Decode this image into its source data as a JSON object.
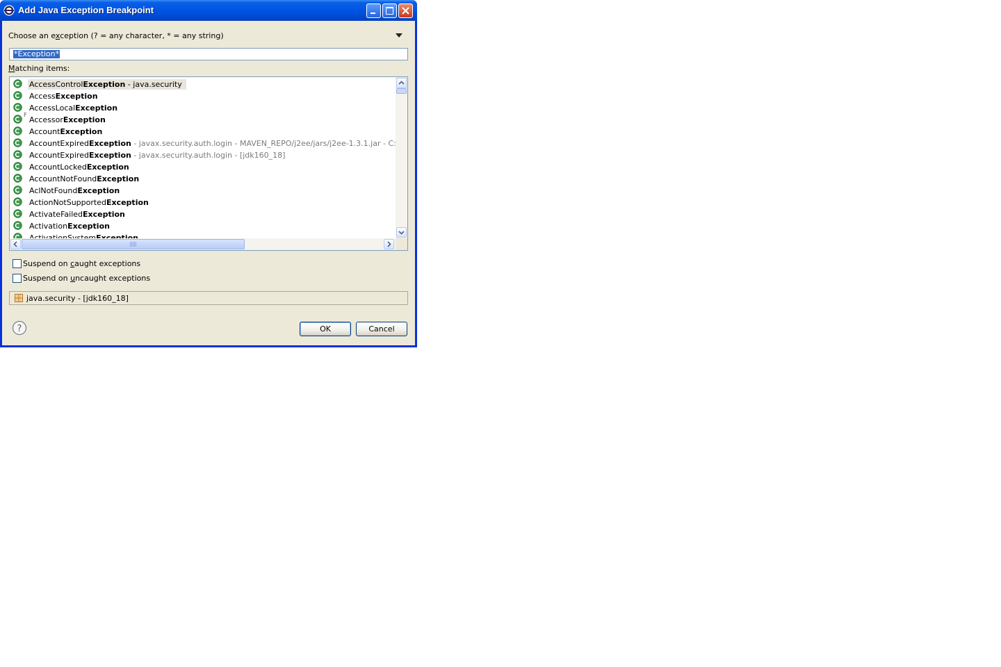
{
  "window": {
    "title": "Add Java Exception Breakpoint"
  },
  "dialog": {
    "choose_label_pre": "Choose an e",
    "choose_label_mnemonic": "x",
    "choose_label_post": "ception (? = any character, * = any string)",
    "search_value": "*Exception*",
    "matching_mnemonic": "M",
    "matching_rest": "atching items:",
    "items": [
      {
        "prefix": "AccessControl",
        "bold": "Exception",
        "qualifier": " - java.security",
        "qualifier_gray": false,
        "selected": true,
        "deco": ""
      },
      {
        "prefix": "Access",
        "bold": "Exception",
        "qualifier": "",
        "qualifier_gray": false,
        "selected": false,
        "deco": ""
      },
      {
        "prefix": "AccessLocal",
        "bold": "Exception",
        "qualifier": "",
        "qualifier_gray": false,
        "selected": false,
        "deco": ""
      },
      {
        "prefix": "Accessor",
        "bold": "Exception",
        "qualifier": "",
        "qualifier_gray": false,
        "selected": false,
        "deco": "F"
      },
      {
        "prefix": "Account",
        "bold": "Exception",
        "qualifier": "",
        "qualifier_gray": false,
        "selected": false,
        "deco": ""
      },
      {
        "prefix": "AccountExpired",
        "bold": "Exception",
        "qualifier": " - javax.security.auth.login - MAVEN_REPO/j2ee/jars/j2ee-1.3.1.jar - C:\\Documents",
        "qualifier_gray": true,
        "selected": false,
        "deco": ""
      },
      {
        "prefix": "AccountExpired",
        "bold": "Exception",
        "qualifier": " - javax.security.auth.login - [jdk160_18]",
        "qualifier_gray": true,
        "selected": false,
        "deco": ""
      },
      {
        "prefix": "AccountLocked",
        "bold": "Exception",
        "qualifier": "",
        "qualifier_gray": false,
        "selected": false,
        "deco": ""
      },
      {
        "prefix": "AccountNotFound",
        "bold": "Exception",
        "qualifier": "",
        "qualifier_gray": false,
        "selected": false,
        "deco": ""
      },
      {
        "prefix": "AclNotFound",
        "bold": "Exception",
        "qualifier": "",
        "qualifier_gray": false,
        "selected": false,
        "deco": ""
      },
      {
        "prefix": "ActionNotSupported",
        "bold": "Exception",
        "qualifier": "",
        "qualifier_gray": false,
        "selected": false,
        "deco": ""
      },
      {
        "prefix": "ActivateFailed",
        "bold": "Exception",
        "qualifier": "",
        "qualifier_gray": false,
        "selected": false,
        "deco": ""
      },
      {
        "prefix": "Activation",
        "bold": "Exception",
        "qualifier": "",
        "qualifier_gray": false,
        "selected": false,
        "deco": ""
      },
      {
        "prefix": "ActivationSystem",
        "bold": "Exception",
        "qualifier": "",
        "qualifier_gray": false,
        "selected": false,
        "deco": ""
      }
    ],
    "caught": {
      "pre": "Suspend on ",
      "mn": "c",
      "post": "aught exceptions",
      "checked": false
    },
    "uncaught": {
      "pre": "Suspend on ",
      "mn": "u",
      "post": "ncaught exceptions",
      "checked": false
    },
    "status_text": "java.security - [jdk160_18]",
    "ok_label": "OK",
    "cancel_label": "Cancel"
  },
  "icons": {
    "class": "class-icon",
    "package": "package-icon",
    "help": "help-icon"
  }
}
